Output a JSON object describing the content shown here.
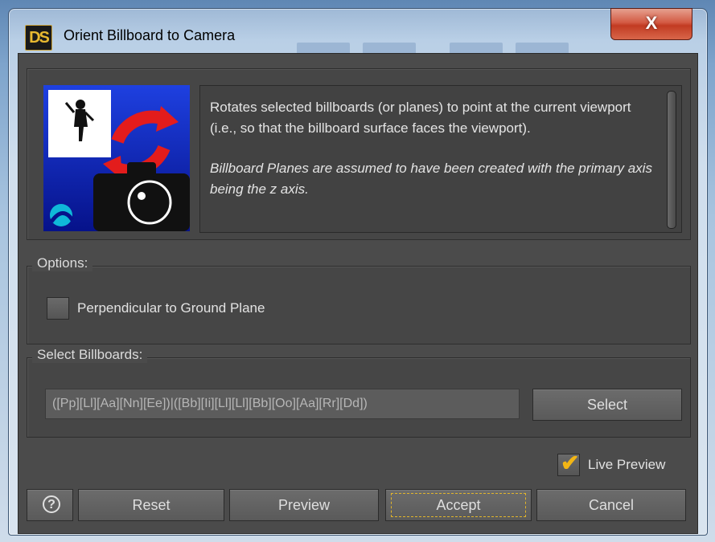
{
  "window": {
    "app_icon_label": "DS",
    "title": "Orient Billboard to Camera",
    "close_label": "X"
  },
  "info": {
    "description": "Rotates selected billboards (or planes) to point at the current viewport (i.e., so that the billboard surface faces the viewport).",
    "note": "Billboard Planes are assumed to have been created with the primary axis being the z axis."
  },
  "options": {
    "legend": "Options:",
    "perpendicular_label": "Perpendicular to Ground Plane",
    "perpendicular_checked": false
  },
  "billboards": {
    "legend": "Select Billboards:",
    "pattern_value": "([Pp][Ll][Aa][Nn][Ee])|([Bb][Ii][Ll][Ll][Bb][Oo][Aa][Rr][Dd])",
    "select_label": "Select"
  },
  "live_preview": {
    "label": "Live Preview",
    "checked": true
  },
  "buttons": {
    "help_label": "?",
    "reset_label": "Reset",
    "preview_label": "Preview",
    "accept_label": "Accept",
    "cancel_label": "Cancel"
  },
  "colors": {
    "accent_yellow": "#e3b52a",
    "panel_bg": "#4b4b4b",
    "close_red": "#c23b22"
  }
}
